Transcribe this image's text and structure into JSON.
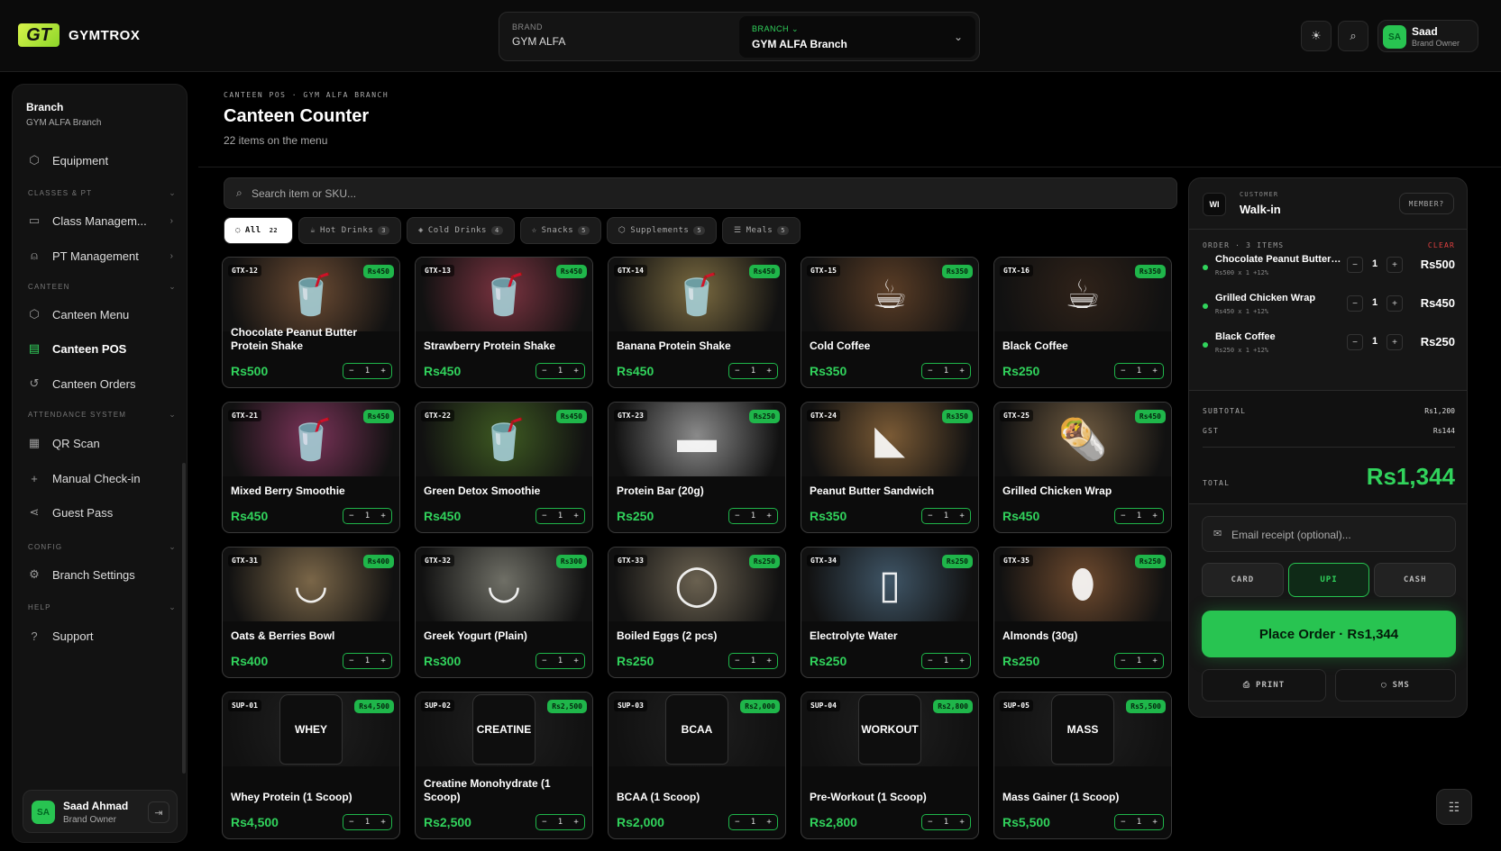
{
  "app": {
    "name": "GYMTROX",
    "logo_text": "GT"
  },
  "selector": {
    "brand_label": "BRAND",
    "brand_value": "GYM ALFA",
    "branch_label": "BRANCH ⌄",
    "branch_value": "GYM ALFA Branch"
  },
  "user": {
    "initials": "SA",
    "name": "Saad",
    "role": "Brand Owner",
    "full_name": "Saad Ahmad"
  },
  "sidebar": {
    "title": "Branch",
    "subtitle": "GYM ALFA Branch",
    "items": [
      {
        "label": "Equipment"
      },
      {
        "label": "CLASSES & PT"
      },
      {
        "label": "Class Managem..."
      },
      {
        "label": "PT Management"
      },
      {
        "label": "CANTEEN"
      },
      {
        "label": "Canteen Menu"
      },
      {
        "label": "Canteen POS"
      },
      {
        "label": "Canteen Orders"
      },
      {
        "label": "ATTENDANCE SYSTEM"
      },
      {
        "label": "QR Scan"
      },
      {
        "label": "Manual Check-in"
      },
      {
        "label": "Guest Pass"
      },
      {
        "label": "CONFIG"
      },
      {
        "label": "Branch Settings"
      },
      {
        "label": "HELP"
      },
      {
        "label": "Support"
      }
    ]
  },
  "page": {
    "breadcrumb": "CANTEEN POS · GYM ALFA BRANCH",
    "title": "Canteen Counter",
    "subtitle": "22 items on the menu"
  },
  "search": {
    "placeholder": "Search item or SKU..."
  },
  "filters": [
    {
      "label": "All",
      "count": "22"
    },
    {
      "label": "Hot Drinks",
      "count": "3"
    },
    {
      "label": "Cold Drinks",
      "count": "4"
    },
    {
      "label": "Snacks",
      "count": "5"
    },
    {
      "label": "Supplements",
      "count": "5"
    },
    {
      "label": "Meals",
      "count": "5"
    }
  ],
  "products": [
    {
      "sku": "GTX-12",
      "tag": "Rs450",
      "name": "Chocolate Peanut Butter Protein Shake",
      "price": "Rs500",
      "qty": "1",
      "color": "#6b4b33",
      "icon": "shake"
    },
    {
      "sku": "GTX-13",
      "tag": "Rs450",
      "name": "Strawberry Protein Shake",
      "price": "Rs450",
      "qty": "1",
      "color": "#7a3340",
      "icon": "shake"
    },
    {
      "sku": "GTX-14",
      "tag": "Rs450",
      "name": "Banana Protein Shake",
      "price": "Rs450",
      "qty": "1",
      "color": "#7a6a40",
      "icon": "shake"
    },
    {
      "sku": "GTX-15",
      "tag": "Rs350",
      "name": "Cold Coffee",
      "price": "Rs350",
      "qty": "1",
      "color": "#5a3d26",
      "icon": "coffee"
    },
    {
      "sku": "GTX-16",
      "tag": "Rs350",
      "name": "Black Coffee",
      "price": "Rs250",
      "qty": "1",
      "color": "#2f2219",
      "icon": "coffee"
    },
    {
      "sku": "GTX-21",
      "tag": "Rs450",
      "name": "Mixed Berry Smoothie",
      "price": "Rs450",
      "qty": "1",
      "color": "#7a3358",
      "icon": "shake"
    },
    {
      "sku": "GTX-22",
      "tag": "Rs450",
      "name": "Green Detox Smoothie",
      "price": "Rs450",
      "qty": "1",
      "color": "#3e5a22",
      "icon": "shake"
    },
    {
      "sku": "GTX-23",
      "tag": "Rs250",
      "name": "Protein Bar (20g)",
      "price": "Rs250",
      "qty": "1",
      "color": "#8a8a8a",
      "icon": "bar"
    },
    {
      "sku": "GTX-24",
      "tag": "Rs350",
      "name": "Peanut Butter Sandwich",
      "price": "Rs350",
      "qty": "1",
      "color": "#7a5a35",
      "icon": "sandwich"
    },
    {
      "sku": "GTX-25",
      "tag": "Rs450",
      "name": "Grilled Chicken Wrap",
      "price": "Rs450",
      "qty": "1",
      "color": "#6e5a40",
      "icon": "wrap"
    },
    {
      "sku": "GTX-31",
      "tag": "Rs400",
      "name": "Oats & Berries Bowl",
      "price": "Rs400",
      "qty": "1",
      "color": "#7a6648",
      "icon": "bowl"
    },
    {
      "sku": "GTX-32",
      "tag": "Rs300",
      "name": "Greek Yogurt (Plain)",
      "price": "Rs300",
      "qty": "1",
      "color": "#6f6f66",
      "icon": "bowl"
    },
    {
      "sku": "GTX-33",
      "tag": "Rs250",
      "name": "Boiled Eggs (2 pcs)",
      "price": "Rs250",
      "qty": "1",
      "color": "#6a6150",
      "icon": "egg"
    },
    {
      "sku": "GTX-34",
      "tag": "Rs250",
      "name": "Electrolyte Water",
      "price": "Rs250",
      "qty": "1",
      "color": "#3f5566",
      "icon": "water"
    },
    {
      "sku": "GTX-35",
      "tag": "Rs250",
      "name": "Almonds (30g)",
      "price": "Rs250",
      "qty": "1",
      "color": "#6e4a2e",
      "icon": "nut"
    },
    {
      "sku": "SUP-01",
      "tag": "Rs4,500",
      "name": "Whey Protein (1 Scoop)",
      "price": "Rs4,500",
      "qty": "1",
      "color": "#202020",
      "icon": "tub",
      "label": "WHEY"
    },
    {
      "sku": "SUP-02",
      "tag": "Rs2,500",
      "name": "Creatine Monohydrate (1 Scoop)",
      "price": "Rs2,500",
      "qty": "1",
      "color": "#202020",
      "icon": "tub",
      "label": "CREATINE"
    },
    {
      "sku": "SUP-03",
      "tag": "Rs2,000",
      "name": "BCAA (1 Scoop)",
      "price": "Rs2,000",
      "qty": "1",
      "color": "#202020",
      "icon": "tub",
      "label": "BCAA"
    },
    {
      "sku": "SUP-04",
      "tag": "Rs2,800",
      "name": "Pre-Workout (1 Scoop)",
      "price": "Rs2,800",
      "qty": "1",
      "color": "#202020",
      "icon": "tub",
      "label": "WORKOUT"
    },
    {
      "sku": "SUP-05",
      "tag": "Rs5,500",
      "name": "Mass Gainer (1 Scoop)",
      "price": "Rs5,500",
      "qty": "1",
      "color": "#202020",
      "icon": "tub",
      "label": "MASS"
    }
  ],
  "order": {
    "customer_label": "CUSTOMER",
    "customer_initials": "WI",
    "customer_value": "Walk-in",
    "member_button": "MEMBER?",
    "header": "ORDER · 3 ITEMS",
    "clear": "CLEAR",
    "items": [
      {
        "name": "Chocolate Peanut Butter Protein Shake",
        "detail": "Rs500 x 1 +12%",
        "qty": "1",
        "price": "Rs500"
      },
      {
        "name": "Grilled Chicken Wrap",
        "detail": "Rs450 x 1 +12%",
        "qty": "1",
        "price": "Rs450"
      },
      {
        "name": "Black Coffee",
        "detail": "Rs250 x 1 +12%",
        "qty": "1",
        "price": "Rs250"
      }
    ],
    "subtotal_label": "SUBTOTAL",
    "subtotal": "Rs1,200",
    "gst_label": "GST",
    "gst": "Rs144",
    "total_label": "TOTAL",
    "total": "Rs1,344",
    "email_placeholder": "Email receipt (optional)...",
    "pay_methods": [
      "CARD",
      "UPI",
      "CASH"
    ],
    "place_order": "Place Order · Rs1,344",
    "print": "PRINT",
    "sms": "SMS"
  },
  "colors": {
    "accent": "#28c451",
    "accent_text": "#31d35c",
    "danger": "#e04040",
    "bg": "#000000"
  }
}
